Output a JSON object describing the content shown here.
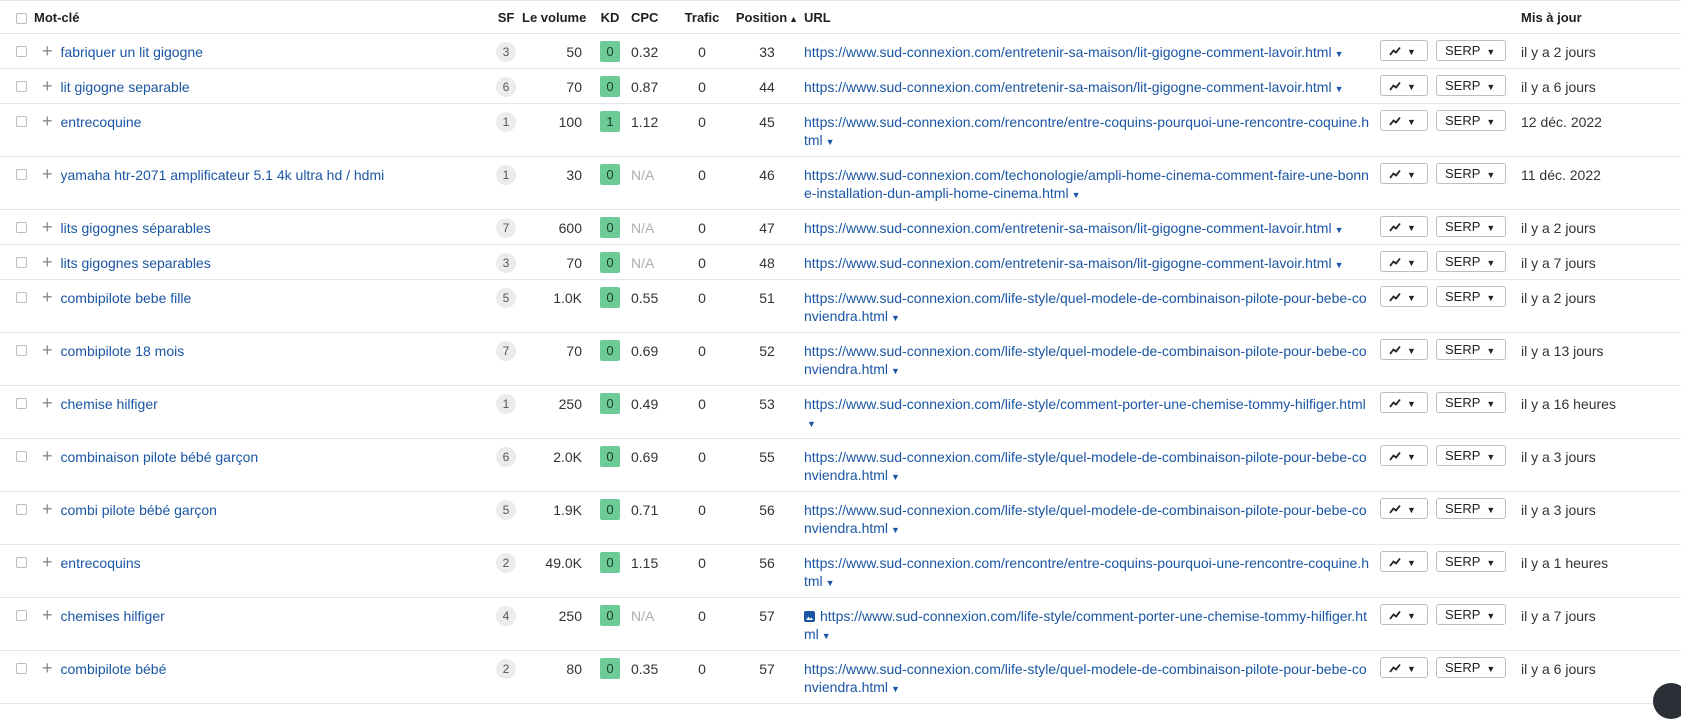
{
  "headers": {
    "keyword": "Mot-clé",
    "sf": "SF",
    "volume": "Le volume",
    "kd": "KD",
    "cpc": "CPC",
    "traffic": "Trafic",
    "position": "Position",
    "url": "URL",
    "updated": "Mis à jour"
  },
  "sort": {
    "column": "position",
    "direction": "asc",
    "icon": "sort-up-icon"
  },
  "buttons": {
    "chart_icon": "trend-line-icon",
    "serp_label": "SERP"
  },
  "colors": {
    "link": "#1a56a4",
    "kd_badge": "#6ccb96",
    "sf_badge": "#ececec",
    "na_text": "#b0b0b0"
  },
  "rows": [
    {
      "keyword": "fabriquer un lit gigogne",
      "sf": "3",
      "volume": "50",
      "kd": "0",
      "cpc": "0.32",
      "traffic": "0",
      "position": "33",
      "url": "https://www.sud-connexion.com/entretenir-sa-maison/lit-gigogne-comment-lavoir.html",
      "updated": "il y a 2 jours"
    },
    {
      "keyword": "lit gigogne separable",
      "sf": "6",
      "volume": "70",
      "kd": "0",
      "cpc": "0.87",
      "traffic": "0",
      "position": "44",
      "url": "https://www.sud-connexion.com/entretenir-sa-maison/lit-gigogne-comment-lavoir.html",
      "updated": "il y a 6 jours"
    },
    {
      "keyword": "entrecoquine",
      "sf": "1",
      "volume": "100",
      "kd": "1",
      "cpc": "1.12",
      "traffic": "0",
      "position": "45",
      "url": "https://www.sud-connexion.com/rencontre/entre-coquins-pourquoi-une-rencontre-coquine.html",
      "updated": "12 déc. 2022"
    },
    {
      "keyword": "yamaha htr-2071 amplificateur 5.1 4k ultra hd / hdmi",
      "sf": "1",
      "volume": "30",
      "kd": "0",
      "cpc": "N/A",
      "traffic": "0",
      "position": "46",
      "url": "https://www.sud-connexion.com/techonologie/ampli-home-cinema-comment-faire-une-bonne-installation-dun-ampli-home-cinema.html",
      "updated": "11 déc. 2022"
    },
    {
      "keyword": "lits gigognes séparables",
      "sf": "7",
      "volume": "600",
      "kd": "0",
      "cpc": "N/A",
      "traffic": "0",
      "position": "47",
      "url": "https://www.sud-connexion.com/entretenir-sa-maison/lit-gigogne-comment-lavoir.html",
      "updated": "il y a 2 jours"
    },
    {
      "keyword": "lits gigognes separables",
      "sf": "3",
      "volume": "70",
      "kd": "0",
      "cpc": "N/A",
      "traffic": "0",
      "position": "48",
      "url": "https://www.sud-connexion.com/entretenir-sa-maison/lit-gigogne-comment-lavoir.html",
      "updated": "il y a 7 jours"
    },
    {
      "keyword": "combipilote bebe fille",
      "sf": "5",
      "volume": "1.0K",
      "kd": "0",
      "cpc": "0.55",
      "traffic": "0",
      "position": "51",
      "url": "https://www.sud-connexion.com/life-style/quel-modele-de-combinaison-pilote-pour-bebe-conviendra.html",
      "updated": "il y a 2 jours"
    },
    {
      "keyword": "combipilote 18 mois",
      "sf": "7",
      "volume": "70",
      "kd": "0",
      "cpc": "0.69",
      "traffic": "0",
      "position": "52",
      "url": "https://www.sud-connexion.com/life-style/quel-modele-de-combinaison-pilote-pour-bebe-conviendra.html",
      "updated": "il y a 13 jours"
    },
    {
      "keyword": "chemise hilfiger",
      "sf": "1",
      "volume": "250",
      "kd": "0",
      "cpc": "0.49",
      "traffic": "0",
      "position": "53",
      "url": "https://www.sud-connexion.com/life-style/comment-porter-une-chemise-tommy-hilfiger.html",
      "updated": "il y a 16 heures"
    },
    {
      "keyword": "combinaison pilote bébé garçon",
      "sf": "6",
      "volume": "2.0K",
      "kd": "0",
      "cpc": "0.69",
      "traffic": "0",
      "position": "55",
      "url": "https://www.sud-connexion.com/life-style/quel-modele-de-combinaison-pilote-pour-bebe-conviendra.html",
      "updated": "il y a 3 jours"
    },
    {
      "keyword": "combi pilote bébé garçon",
      "sf": "5",
      "volume": "1.9K",
      "kd": "0",
      "cpc": "0.71",
      "traffic": "0",
      "position": "56",
      "url": "https://www.sud-connexion.com/life-style/quel-modele-de-combinaison-pilote-pour-bebe-conviendra.html",
      "updated": "il y a 3 jours"
    },
    {
      "keyword": "entrecoquins",
      "sf": "2",
      "volume": "49.0K",
      "kd": "0",
      "cpc": "1.15",
      "traffic": "0",
      "position": "56",
      "url": "https://www.sud-connexion.com/rencontre/entre-coquins-pourquoi-une-rencontre-coquine.html",
      "updated": "il y a 1 heures"
    },
    {
      "keyword": "chemises hilfiger",
      "sf": "4",
      "volume": "250",
      "kd": "0",
      "cpc": "N/A",
      "traffic": "0",
      "position": "57",
      "url": "https://www.sud-connexion.com/life-style/comment-porter-une-chemise-tommy-hilfiger.html",
      "updated": "il y a 7 jours",
      "url_icon": "image-icon"
    },
    {
      "keyword": "combipilote bébé",
      "sf": "2",
      "volume": "80",
      "kd": "0",
      "cpc": "0.35",
      "traffic": "0",
      "position": "57",
      "url": "https://www.sud-connexion.com/life-style/quel-modele-de-combinaison-pilote-pour-bebe-conviendra.html",
      "updated": "il y a 6 jours"
    }
  ]
}
